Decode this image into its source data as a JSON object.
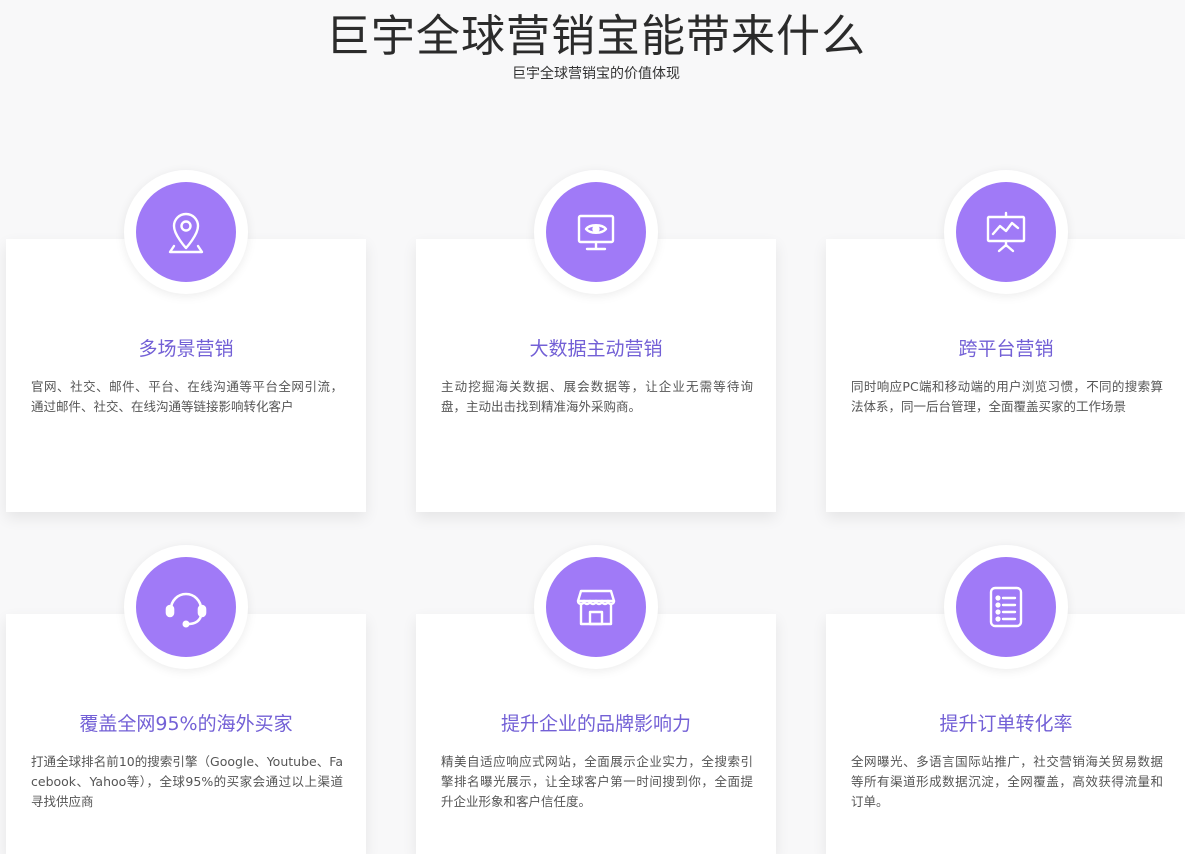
{
  "header": {
    "title": "巨宇全球营销宝能带来什么",
    "subtitle": "巨宇全球营销宝的价值体现"
  },
  "colors": {
    "icon_bg": "#a07af7",
    "title": "#7360d6",
    "text": "#555555",
    "page_bg": "#f8f8f9"
  },
  "cards": [
    {
      "icon": "location-pin-icon",
      "title": "多场景营销",
      "desc": "官网、社交、邮件、平台、在线沟通等平台全网引流，通过邮件、社交、在线沟通等链接影响转化客户"
    },
    {
      "icon": "monitor-eye-icon",
      "title": "大数据主动营销",
      "desc": "主动挖掘海关数据、展会数据等，让企业无需等待询盘，主动出击找到精准海外采购商。"
    },
    {
      "icon": "presentation-chart-icon",
      "title": "跨平台营销",
      "desc": "同时响应PC端和移动端的用户浏览习惯，不同的搜索算法体系，同一后台管理，全面覆盖买家的工作场景"
    },
    {
      "icon": "headset-icon",
      "title": "覆盖全网95%的海外买家",
      "desc": "打通全球排名前10的搜索引擎（Google、Youtube、Facebook、Yahoo等），全球95%的买家会通过以上渠道寻找供应商"
    },
    {
      "icon": "storefront-icon",
      "title": "提升企业的品牌影响力",
      "desc": "精美自适应响应式网站，全面展示企业实力，全搜索引擎排名曝光展示，让全球客户第一时间搜到你，全面提升企业形象和客户信任度。"
    },
    {
      "icon": "list-document-icon",
      "title": "提升订单转化率",
      "desc": "全网曝光、多语言国际站推广，社交营销海关贸易数据等所有渠道形成数据沉淀，全网覆盖，高效获得流量和订单。"
    }
  ]
}
